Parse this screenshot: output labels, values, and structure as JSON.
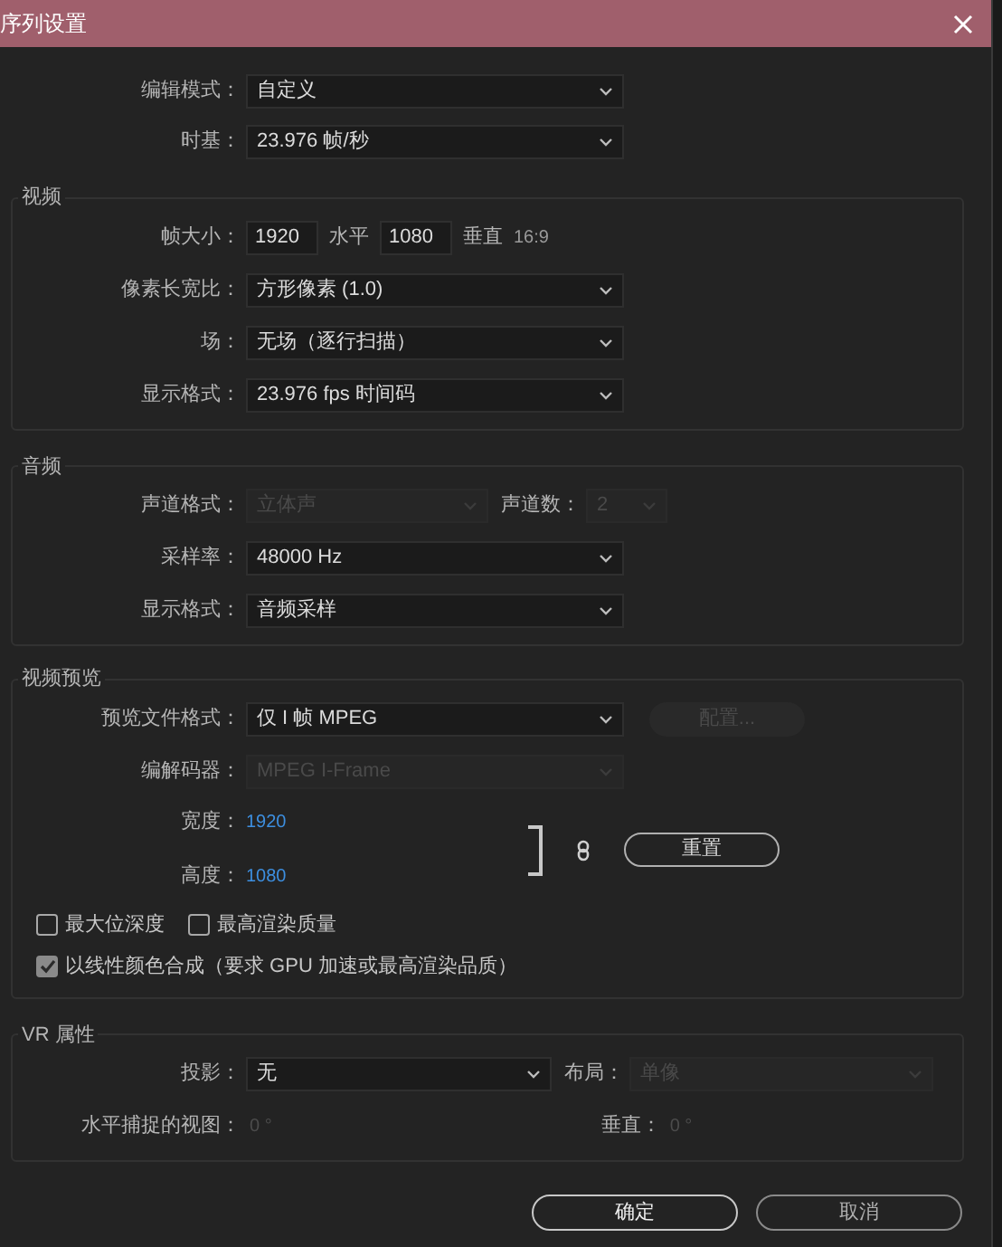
{
  "window": {
    "title": "序列设置"
  },
  "general": [
    {
      "label": "编辑模式：",
      "controls": [
        {
          "kind": "dropdown",
          "value": "自定义",
          "disabled": false
        }
      ]
    },
    {
      "label": "时基：",
      "controls": [
        {
          "kind": "dropdown",
          "value": "23.976  帧/秒",
          "disabled": false
        }
      ]
    }
  ],
  "sections": [
    {
      "title": "视频",
      "rows": [
        {
          "label": "帧大小：",
          "controls": [
            {
              "kind": "input",
              "value": "1920"
            },
            {
              "kind": "text",
              "value": "水平"
            },
            {
              "kind": "input",
              "value": "1080"
            },
            {
              "kind": "text",
              "value": "垂直"
            },
            {
              "kind": "note",
              "value": "16:9"
            }
          ]
        },
        {
          "label": "像素长宽比：",
          "controls": [
            {
              "kind": "dropdown",
              "value": "方形像素 (1.0)",
              "disabled": false
            }
          ]
        },
        {
          "label": "场：",
          "controls": [
            {
              "kind": "dropdown",
              "value": "无场（逐行扫描）",
              "disabled": false
            }
          ]
        },
        {
          "label": "显示格式：",
          "controls": [
            {
              "kind": "dropdown",
              "value": "23.976 fps 时间码",
              "disabled": false
            }
          ]
        }
      ]
    },
    {
      "title": "音频",
      "rows": [
        {
          "label": "声道格式：",
          "controls": [
            {
              "kind": "short_dropdown",
              "value": "立体声",
              "disabled": true
            },
            {
              "kind": "side_label",
              "value": "声道数："
            },
            {
              "kind": "mini_dropdown",
              "value": "2",
              "disabled": true
            }
          ]
        },
        {
          "label": "采样率：",
          "controls": [
            {
              "kind": "dropdown",
              "value": "48000 Hz",
              "disabled": false
            }
          ]
        },
        {
          "label": "显示格式：",
          "controls": [
            {
              "kind": "dropdown",
              "value": "音频采样",
              "disabled": false
            }
          ]
        }
      ]
    },
    {
      "title": "视频预览",
      "rows": [
        {
          "label": "预览文件格式：",
          "controls": [
            {
              "kind": "dropdown",
              "value": "仅 I 帧 MPEG",
              "disabled": false
            },
            {
              "kind": "button",
              "value": "配置...",
              "disabled": true
            }
          ]
        },
        {
          "label": "编解码器：",
          "controls": [
            {
              "kind": "dropdown",
              "value": "MPEG I-Frame",
              "disabled": true
            }
          ]
        }
      ],
      "dimensions": {
        "width": {
          "label": "宽度：",
          "value": "1920"
        },
        "height": {
          "label": "高度：",
          "value": "1080"
        },
        "reset_button": "重置"
      },
      "checkbox_rows": [
        [
          {
            "label": "最大位深度",
            "checked": false
          },
          {
            "label": "最高渲染质量",
            "checked": false
          }
        ],
        [
          {
            "label": "以线性颜色合成（要求 GPU 加速或最高渲染品质）",
            "checked": true
          }
        ]
      ]
    },
    {
      "title": "VR 属性",
      "rows": [
        {
          "label": "投影：",
          "controls": [
            {
              "kind": "mid_dropdown",
              "value": "无",
              "disabled": false
            },
            {
              "kind": "side_label",
              "value": "布局："
            },
            {
              "kind": "wide_dropdown",
              "value": "单像",
              "disabled": true
            }
          ]
        },
        {
          "label": "水平捕捉的视图：",
          "controls": [
            {
              "kind": "dim_value",
              "value": "0 °"
            },
            {
              "kind": "gap"
            },
            {
              "kind": "side_label",
              "value": "垂直："
            },
            {
              "kind": "dim_value",
              "value": "0 °"
            }
          ]
        }
      ]
    }
  ],
  "buttons": [
    {
      "label": "确定",
      "primary": true
    },
    {
      "label": "取消",
      "primary": false
    }
  ]
}
